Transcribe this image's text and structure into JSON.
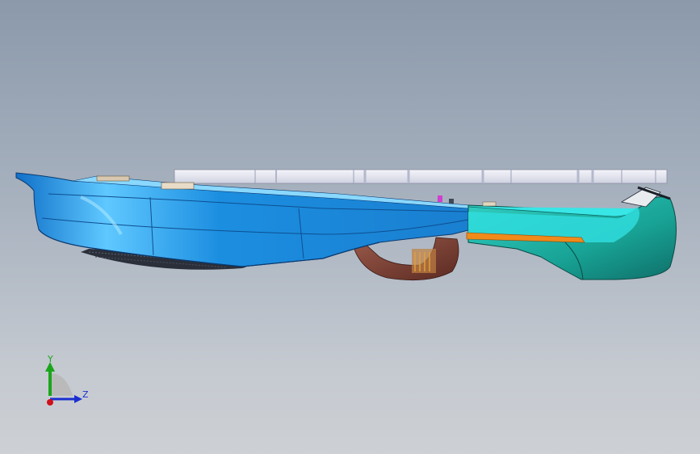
{
  "viewport": {
    "background_top": "#8b99ab",
    "background_bottom": "#cdd0d4"
  },
  "model": {
    "description_icon": "3d-cad-assembly-side-view",
    "colors": {
      "hull_blue": "#1f8fe0",
      "hull_blue_light": "#5fc0ff",
      "rear_teal": "#1fb3a6",
      "rear_teal_dark": "#157f77",
      "cyan_panel": "#2fe0e0",
      "orange_rod": "#f08a1a",
      "brown_housing": "#7a3f33",
      "grey_plate": "#e6e6ef",
      "tread_dark": "#2a2f3a",
      "magenta_pin": "#d040d0"
    }
  },
  "triad": {
    "y_label": "Y",
    "z_label": "Z",
    "y_color": "#1aa61a",
    "z_color": "#1b2fd0",
    "x_color": "#d0101a"
  }
}
